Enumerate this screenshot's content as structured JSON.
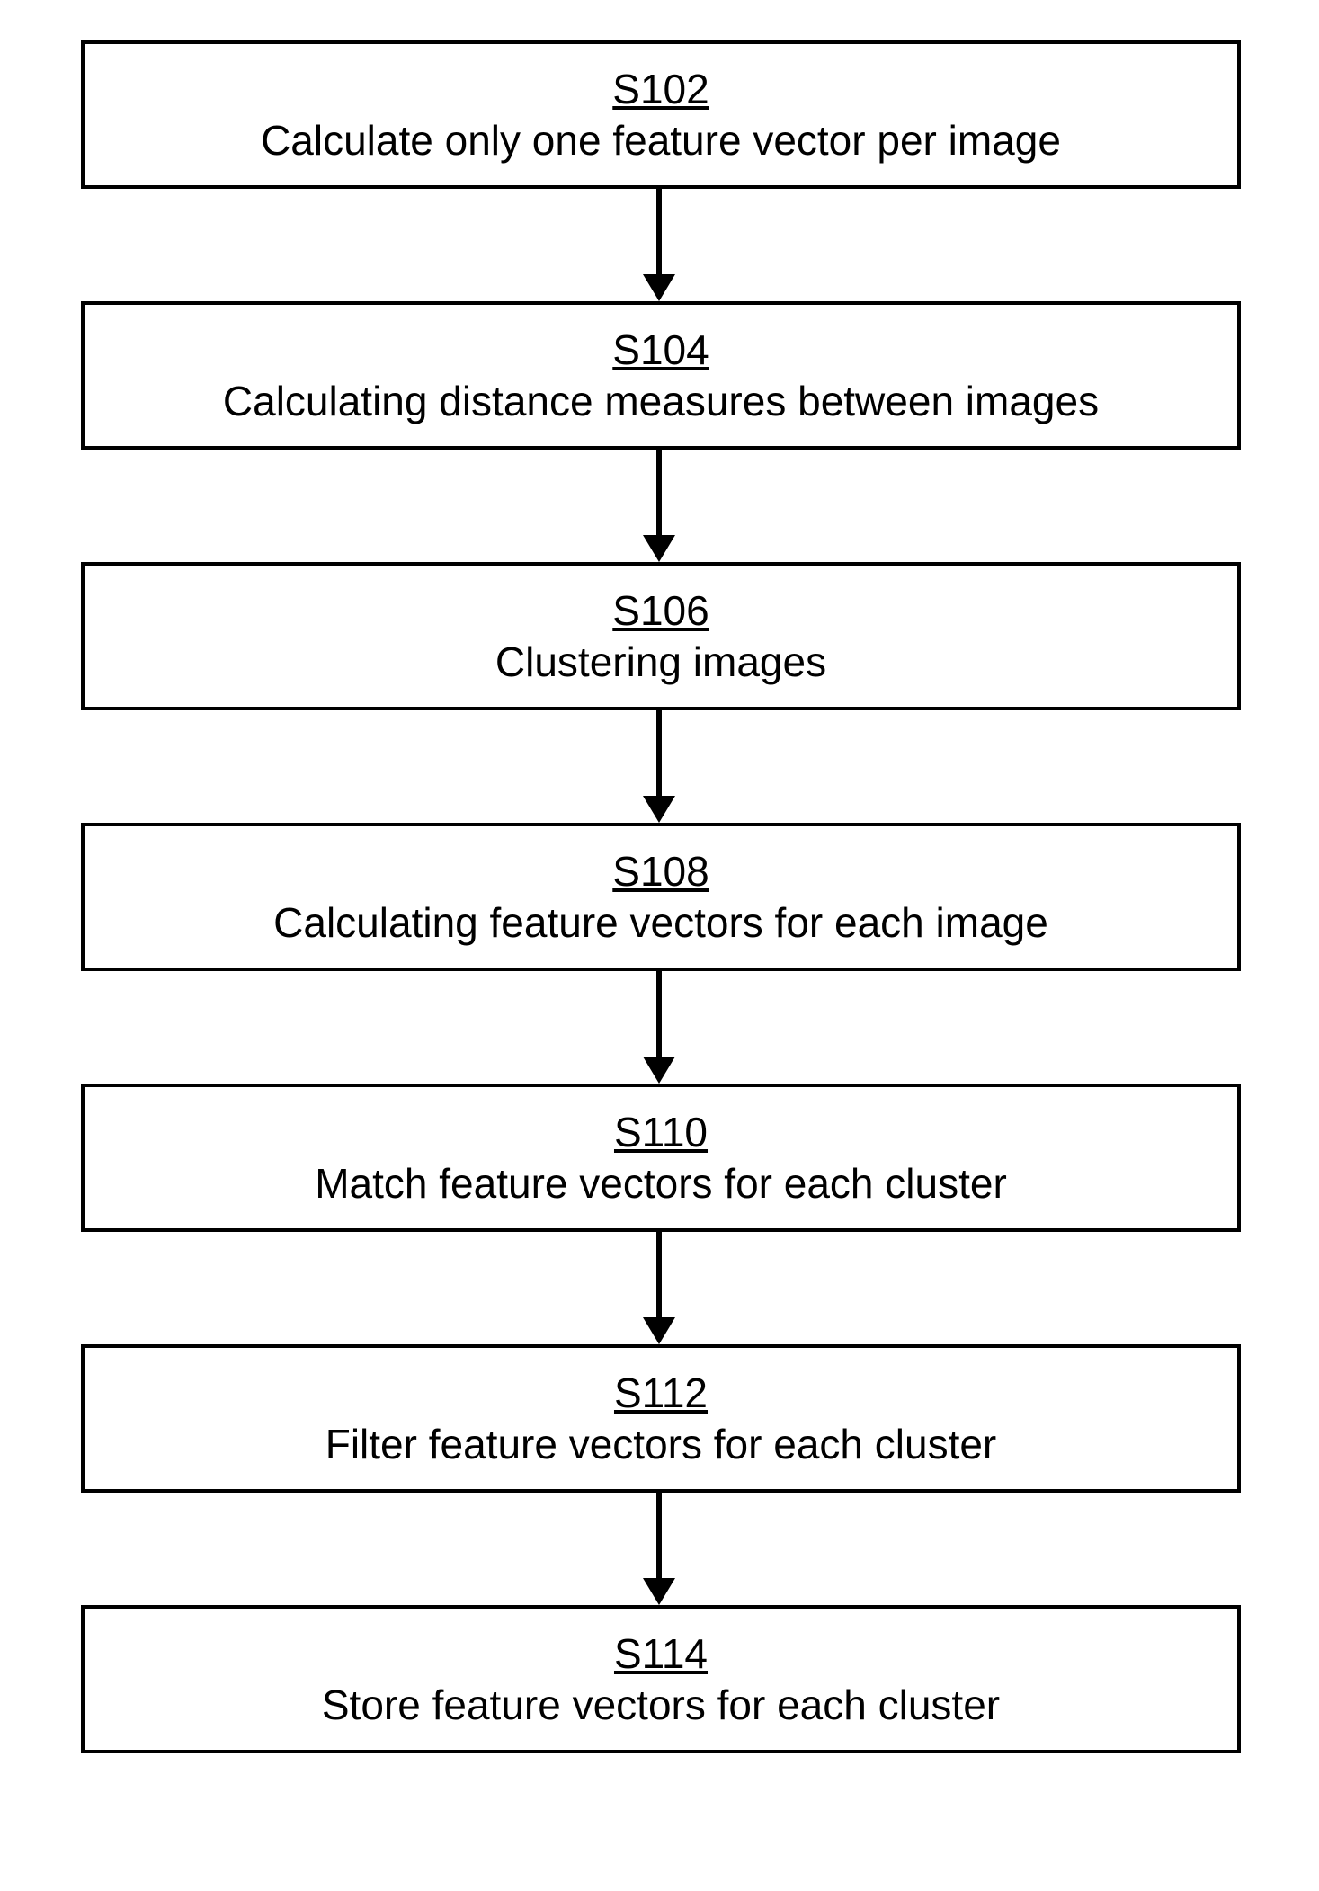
{
  "diagram": {
    "type": "flowchart",
    "direction": "top-to-bottom",
    "steps": [
      {
        "id": "S102",
        "text": "Calculate only one feature vector per image"
      },
      {
        "id": "S104",
        "text": "Calculating distance measures between images"
      },
      {
        "id": "S106",
        "text": "Clustering images"
      },
      {
        "id": "S108",
        "text": "Calculating feature vectors for each image"
      },
      {
        "id": "S110",
        "text": "Match feature vectors for each cluster"
      },
      {
        "id": "S112",
        "text": "Filter feature vectors for each cluster"
      },
      {
        "id": "S114",
        "text": "Store feature vectors for each cluster"
      }
    ],
    "edges": [
      {
        "from": "S102",
        "to": "S104"
      },
      {
        "from": "S104",
        "to": "S106"
      },
      {
        "from": "S106",
        "to": "S108"
      },
      {
        "from": "S108",
        "to": "S110"
      },
      {
        "from": "S110",
        "to": "S112"
      },
      {
        "from": "S112",
        "to": "S114"
      }
    ]
  }
}
